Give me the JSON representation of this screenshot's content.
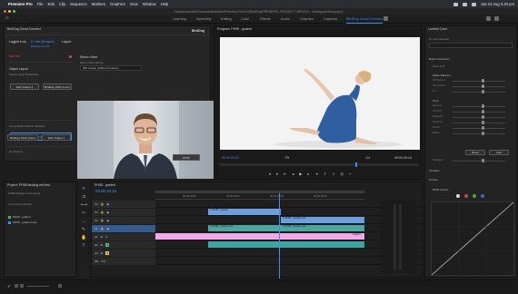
{
  "menubar": {
    "app": "Premiere Pro",
    "items": [
      "File",
      "Edit",
      "Clip",
      "Sequence",
      "Markers",
      "Graphics",
      "View",
      "Window",
      "Help"
    ],
    "clock": "Sat 24 Aug 3:40 pm"
  },
  "window": {
    "title": "/Users/eudorable/Documents/Adobe/Premiere Pro/24.0/BirdDog/PREMIERE_PROJECT / BIRDOG - birddog-ext-test.prproj *"
  },
  "workspaces": [
    "Learning",
    "Assembly",
    "Editing",
    "Color",
    "Effects",
    "Audio",
    "Graphics",
    "Captions",
    "BirdDog Cloud Connect"
  ],
  "active_workspace": "BirdDog Cloud Connect",
  "plugin": {
    "tab": "BirdDog Cloud Connect",
    "logo": "BirdDog",
    "logged_in_label": "Logged in as",
    "user": "D. Hall (Designer)",
    "account_link": "BirdDog Account",
    "logout": "Logout",
    "status": "Not Live",
    "output_layout": "Output Layout",
    "output_layout_hint": "Select Layout Perspective",
    "layout_btn_1": "Web Output 1",
    "layout_btn_2": "BirdDog PAW (1 am)",
    "return_video": "Return Video",
    "return_source_label": "Return Video Source",
    "return_source_value": "NDI Output (Adobe Premiere)",
    "shared_source_label": "Screenshared Source Selection",
    "shared_source_btn": "NDI Source (Adobe NDI 1)",
    "sources_label": "Go Sources",
    "source_1": "BirdDog P100 (Cam)",
    "source_2": "Web Output 1",
    "stop": "STOP"
  },
  "program": {
    "tab": "Program: PH08 - graded",
    "tc_in": "00:00:22:42",
    "fit": "Fit",
    "ratio": "1/4",
    "tc_out": "00:00:33:14"
  },
  "lumetri": {
    "tab": "Lumetri Color",
    "source": "No clip selected",
    "basic": "Basic Correction",
    "input_lut": "Input LUT",
    "white_balance": "White Balance",
    "wb_sel": "WB Selector",
    "temperature": "Temperature",
    "tint": "Tint",
    "tone": "Tone",
    "rows": [
      "Exposure",
      "Contrast",
      "Highlights",
      "Shadows",
      "Whites",
      "Blacks"
    ],
    "reset": "Reset",
    "auto": "Auto",
    "saturation": "Saturation",
    "creative": "Creative",
    "curves": "Curves",
    "rgb_curves": "RGB Curves",
    "hue_sat": "Hue Saturation Curves"
  },
  "project": {
    "tab": "Project: PH08 birddog-ext-test",
    "path": "PH08 birddog-ext-test.prproj",
    "items_label": "1 of 2 items selected",
    "rows": [
      {
        "name": "PH08 - graded",
        "color": "#42b851"
      },
      {
        "name": "PH08 - graded.mp4",
        "color": "#3d8df5"
      }
    ]
  },
  "timeline": {
    "tab": "PH08 - graded",
    "timecode": "00:00:22:42",
    "ruler": [
      "00:00:15:00",
      "00:00:20:00",
      "00:00:25:00",
      "00:00:30:00"
    ],
    "tracks": [
      "V4",
      "V3",
      "V2",
      "V1",
      "A1",
      "A2",
      "A3",
      "Mix"
    ],
    "clip_v3": "fx PH08 - graded",
    "clip_v2b": "fx PH08 - graded.mp4",
    "clip_v1a": "fx PH08 - graded.mp4",
    "clip_v1b": "fx PH08 - graded.mp4",
    "clip_pink": "Graphic",
    "mix_val": "0.0"
  },
  "colors": {
    "accent": "#3d8df5",
    "clip_blue": "#6b9fe0",
    "clip_teal": "#4aa7a0",
    "clip_pink": "#f0a8e8",
    "clip_green": "#4ec07a",
    "live_red": "#e04848"
  }
}
